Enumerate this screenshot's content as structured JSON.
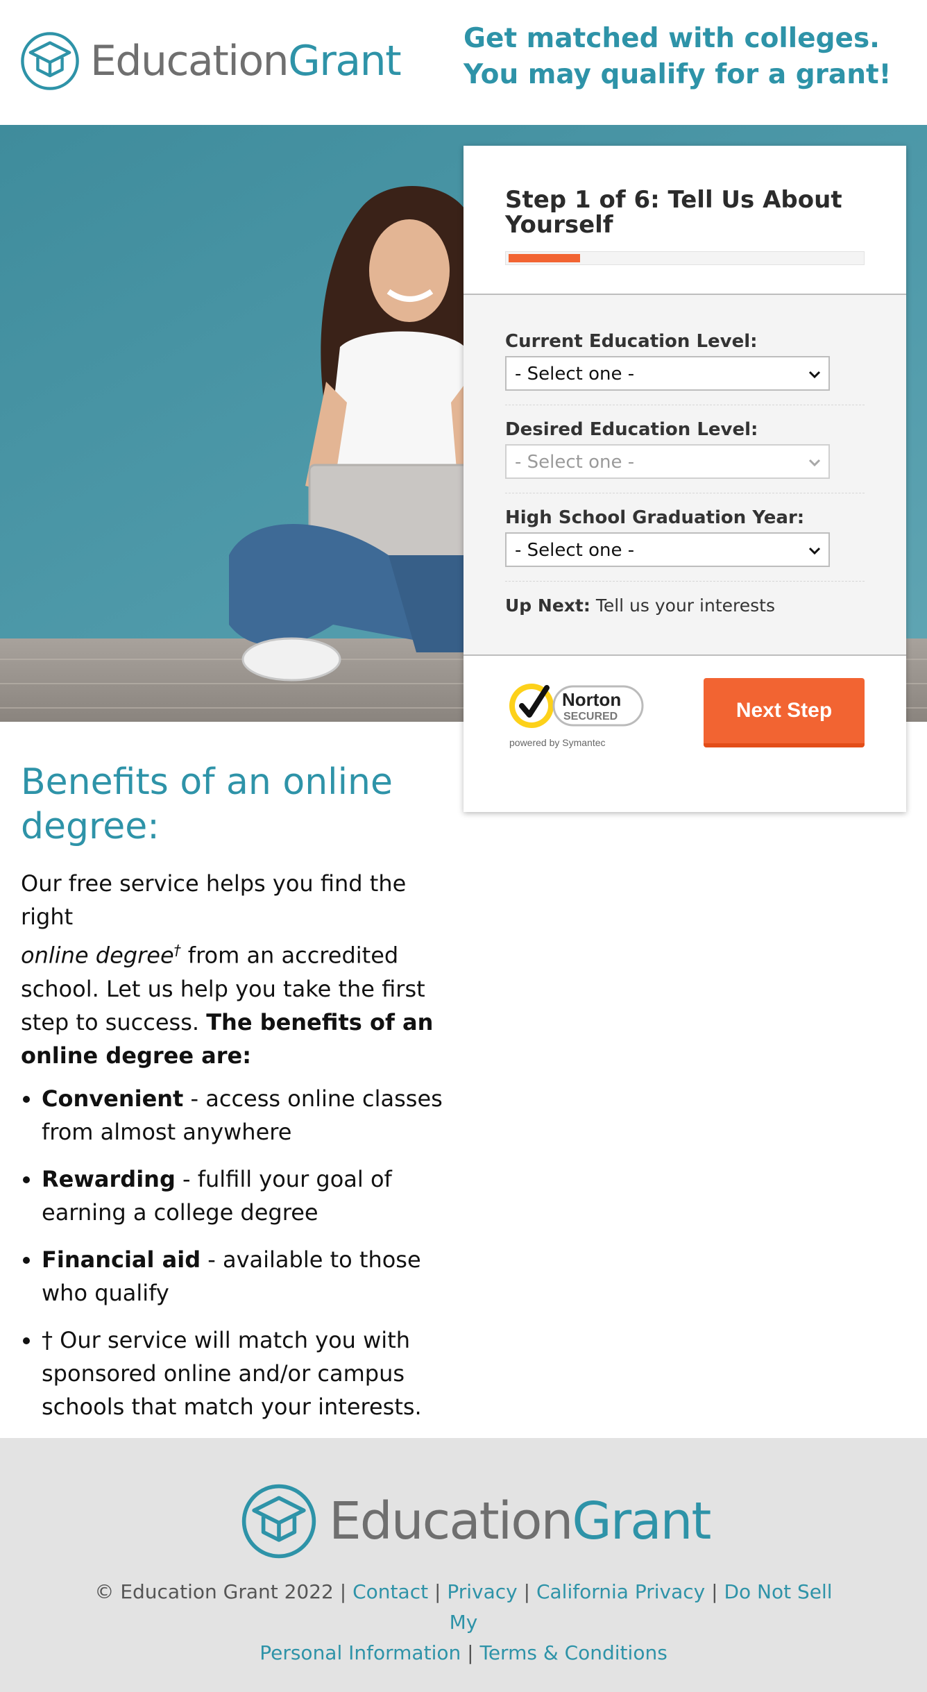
{
  "header": {
    "logo": {
      "edu": "Education",
      "grant": "Grant"
    },
    "tagline_line1": "Get matched with colleges.",
    "tagline_line2": "You may qualify for a grant!"
  },
  "form": {
    "title": "Step 1 of 6: Tell Us About Yourself",
    "progress_fraction": 0.2,
    "fields": [
      {
        "label": "Current Education Level:",
        "value": "- Select one -",
        "disabled": false
      },
      {
        "label": "Desired Education Level:",
        "value": "- Select one -",
        "disabled": true
      },
      {
        "label": "High School Graduation Year:",
        "value": "- Select one -",
        "disabled": false
      }
    ],
    "up_next_label": "Up Next:",
    "up_next_text": "Tell us your interests",
    "norton": {
      "brand": "Norton",
      "secured": "SECURED",
      "powered": "powered by Symantec"
    },
    "next_button": "Next Step"
  },
  "benefits": {
    "heading_line1": "Benefits of an online",
    "heading_line2": "degree:",
    "intro_part1": "Our free service helps you find the right",
    "intro_italic": "online degree",
    "intro_dagger": "†",
    "intro_part2": " from an accredited school. Let us help you take the first step to success. ",
    "intro_bold": "The benefits of an online degree are:",
    "items": [
      {
        "bold": "Convenient",
        "text": " - access online classes from almost anywhere"
      },
      {
        "bold": "Rewarding",
        "text": " - fulfill your goal of earning a college degree"
      },
      {
        "bold": "Financial aid",
        "text": " - available to those who qualify"
      },
      {
        "bold": "",
        "text": "† Our service will match you with sponsored online and/or campus schools that match your interests."
      }
    ]
  },
  "footer": {
    "logo": {
      "edu": "Education",
      "grant": "Grant"
    },
    "copyright": "© Education Grant 2022",
    "links": {
      "contact": "Contact",
      "privacy": "Privacy",
      "california": "California Privacy",
      "donotsell_1": "Do Not Sell My",
      "donotsell_2": "Personal Information",
      "terms": "Terms & Conditions"
    },
    "separator": "|"
  },
  "colors": {
    "brand_teal": "#2e93a8",
    "accent_orange": "#f26432",
    "hero_wall": "#4b95a4"
  }
}
